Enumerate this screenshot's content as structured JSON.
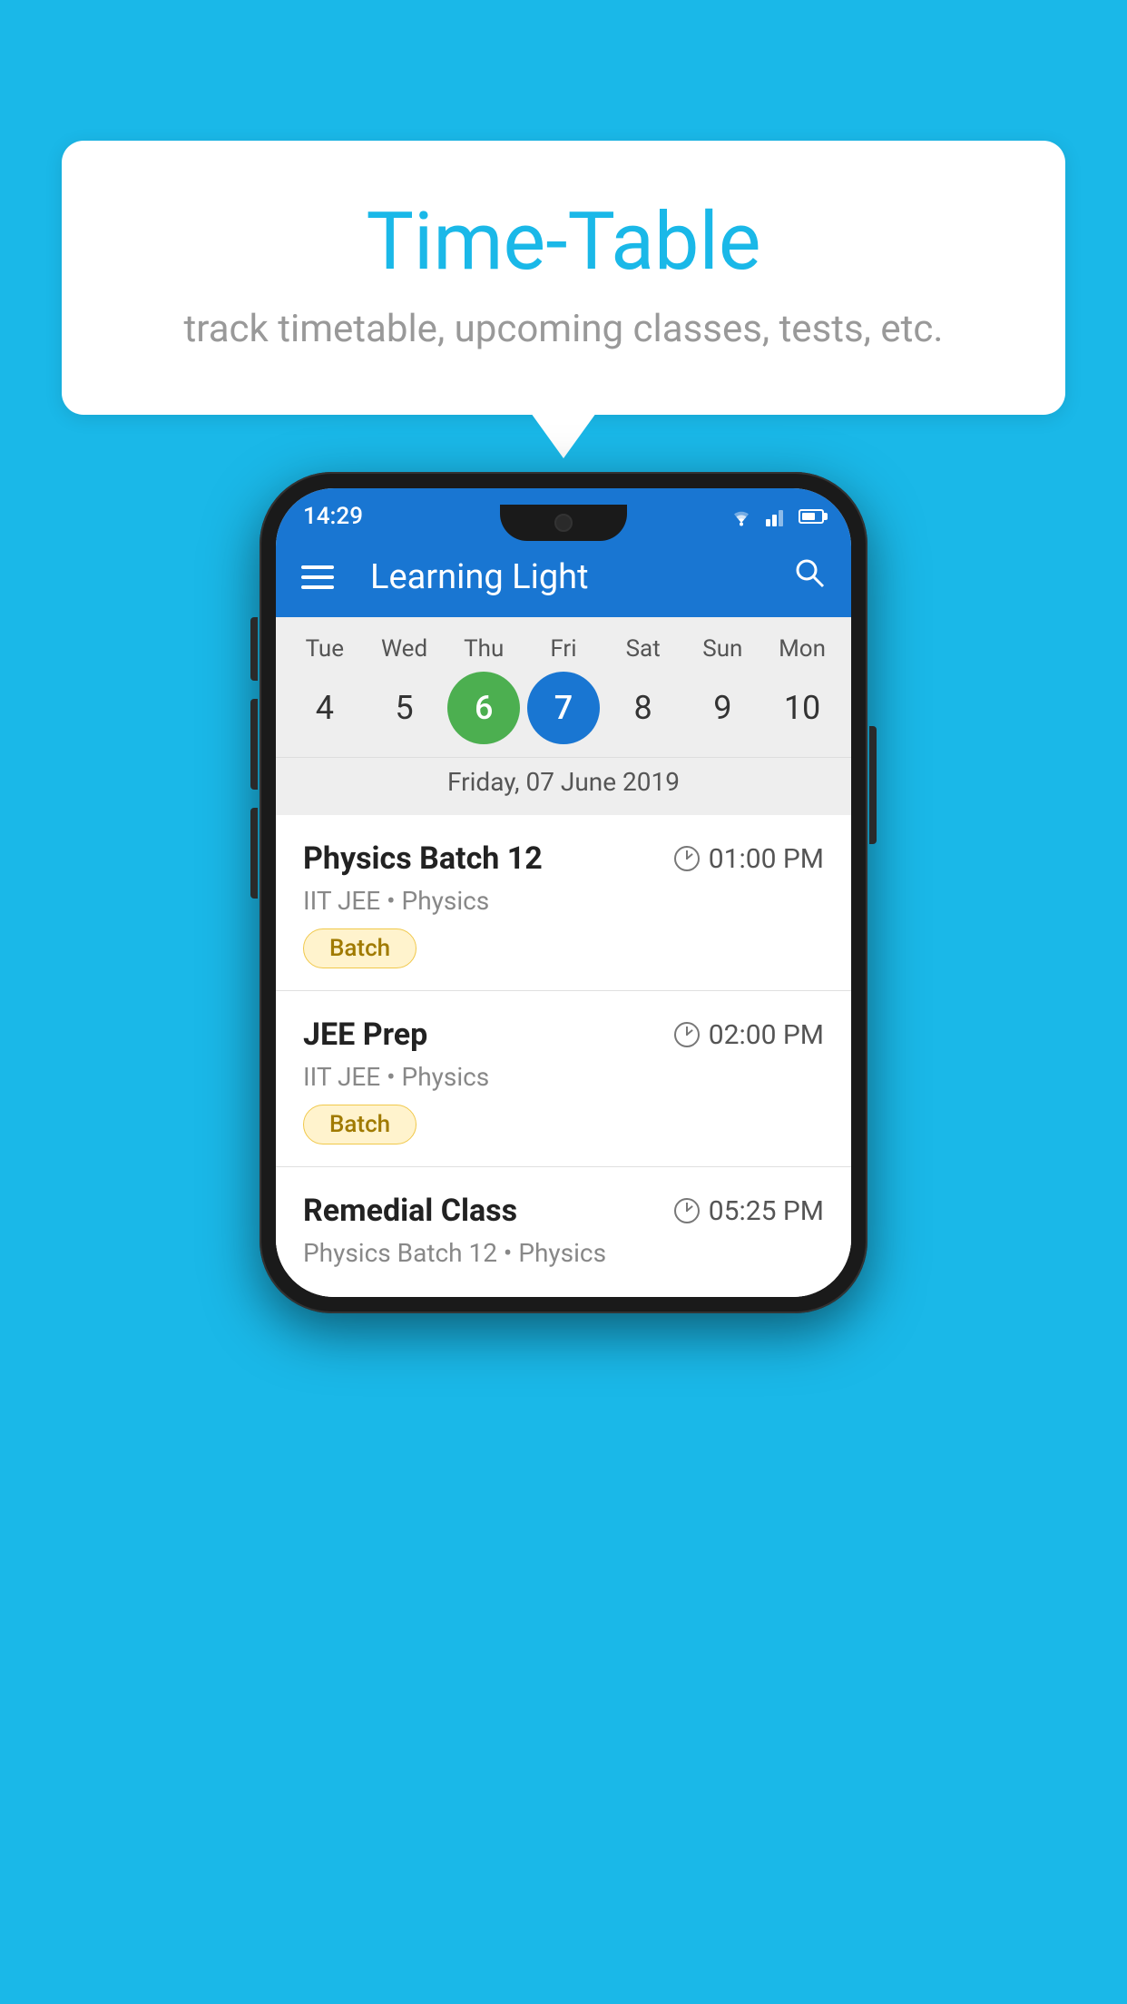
{
  "page": {
    "background_color": "#1ab8e8"
  },
  "speech_bubble": {
    "title": "Time-Table",
    "subtitle": "track timetable, upcoming classes, tests, etc."
  },
  "phone": {
    "status_bar": {
      "time": "14:29"
    },
    "app_bar": {
      "title": "Learning Light"
    },
    "calendar": {
      "days": [
        "Tue",
        "Wed",
        "Thu",
        "Fri",
        "Sat",
        "Sun",
        "Mon"
      ],
      "dates": [
        "4",
        "5",
        "6",
        "7",
        "8",
        "9",
        "10"
      ],
      "today_index": 2,
      "selected_index": 3,
      "selected_label": "Friday, 07 June 2019"
    },
    "schedule": [
      {
        "title": "Physics Batch 12",
        "time": "01:00 PM",
        "subtitle": "IIT JEE • Physics",
        "badge": "Batch"
      },
      {
        "title": "JEE Prep",
        "time": "02:00 PM",
        "subtitle": "IIT JEE • Physics",
        "badge": "Batch"
      },
      {
        "title": "Remedial Class",
        "time": "05:25 PM",
        "subtitle": "Physics Batch 12 • Physics",
        "badge": null
      }
    ]
  }
}
